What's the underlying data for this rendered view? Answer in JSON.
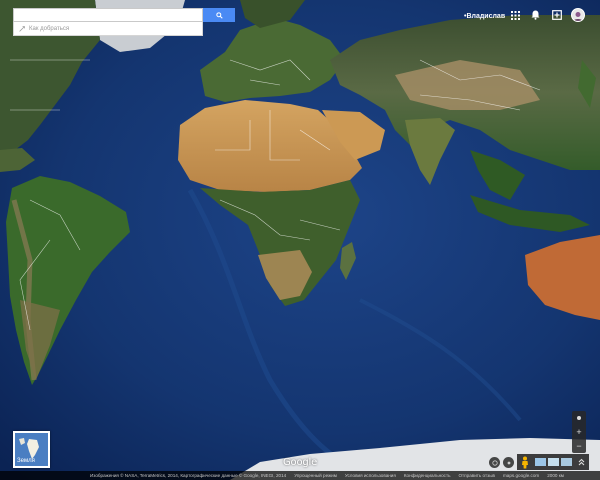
{
  "search": {
    "value": "",
    "placeholder": ""
  },
  "directions": {
    "label": "Как добраться"
  },
  "header": {
    "user_name": "•Владислав"
  },
  "earth_toggle": {
    "label": "Земля"
  },
  "zoom": {
    "in_label": "+",
    "out_label": "−"
  },
  "logo": {
    "text": "Google"
  },
  "footer": {
    "attribution": "Изображения © NASA, TerraMetrics, 2014, Картографические данные © Google, INEGI, 2014",
    "terms": "Упрощенный режим",
    "privacy": "Условия использования",
    "feedback": "Конфиденциальность",
    "report": "Отправить отзыв",
    "link": "maps.google.com",
    "scale": "2000 км"
  },
  "colors": {
    "ocean": "#12306b",
    "land_green": "#3e5c2a",
    "desert": "#c89456",
    "accent": "#4a8af4"
  },
  "icons": [
    "search-icon",
    "directions-icon",
    "apps-grid-icon",
    "notification-bell-icon",
    "share-plus-icon",
    "avatar",
    "pegman-icon",
    "expand-icon",
    "compass-icon",
    "help-icon"
  ]
}
